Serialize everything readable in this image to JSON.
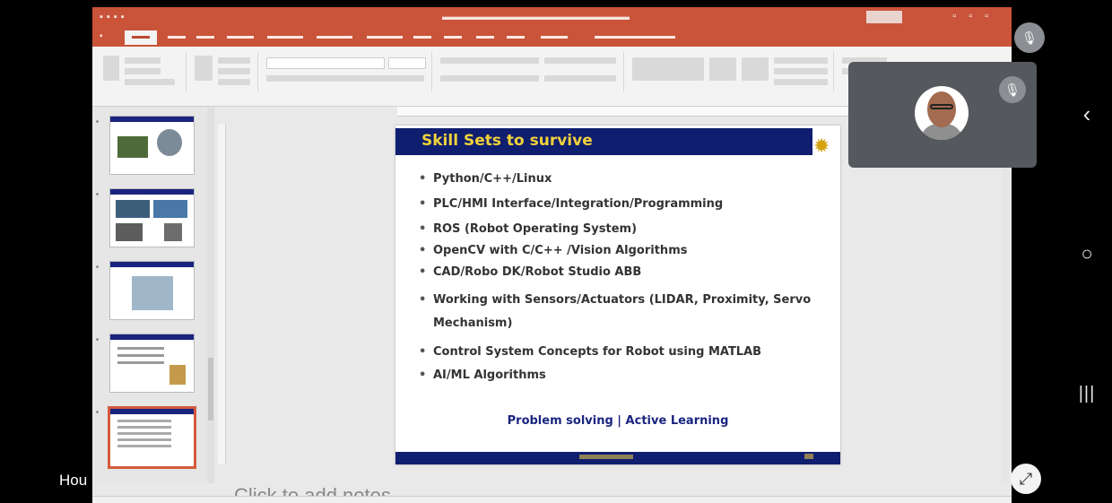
{
  "slide": {
    "title": "Skill Sets to survive",
    "bullets": [
      "Python/C++/Linux",
      "PLC/HMI Interface/Integration/Programming",
      "ROS (Robot Operating System)",
      "OpenCV with C/C++ /Vision Algorithms",
      "CAD/Robo DK/Robot Studio ABB",
      "Working with Sensors/Actuators (LIDAR, Proximity, Servo Mechanism)",
      "Control System Concepts for Robot using MATLAB",
      "AI/ML Algorithms"
    ],
    "emphasis": "Problem solving | Active Learning"
  },
  "notes": {
    "placeholder": "Click to add notes"
  },
  "overlay": {
    "participant_name": "Hou",
    "icons": {
      "mic_off": "mic-off-icon",
      "back": "back-icon",
      "home": "home-icon",
      "recents": "recents-icon",
      "rotate": "rotate-icon"
    }
  },
  "colors": {
    "title_bar": "#c9543a",
    "slide_header": "#0f1e6e",
    "slide_title": "#f2d23b",
    "emphasis_text": "#1a2580",
    "selection": "#d35a3c"
  }
}
